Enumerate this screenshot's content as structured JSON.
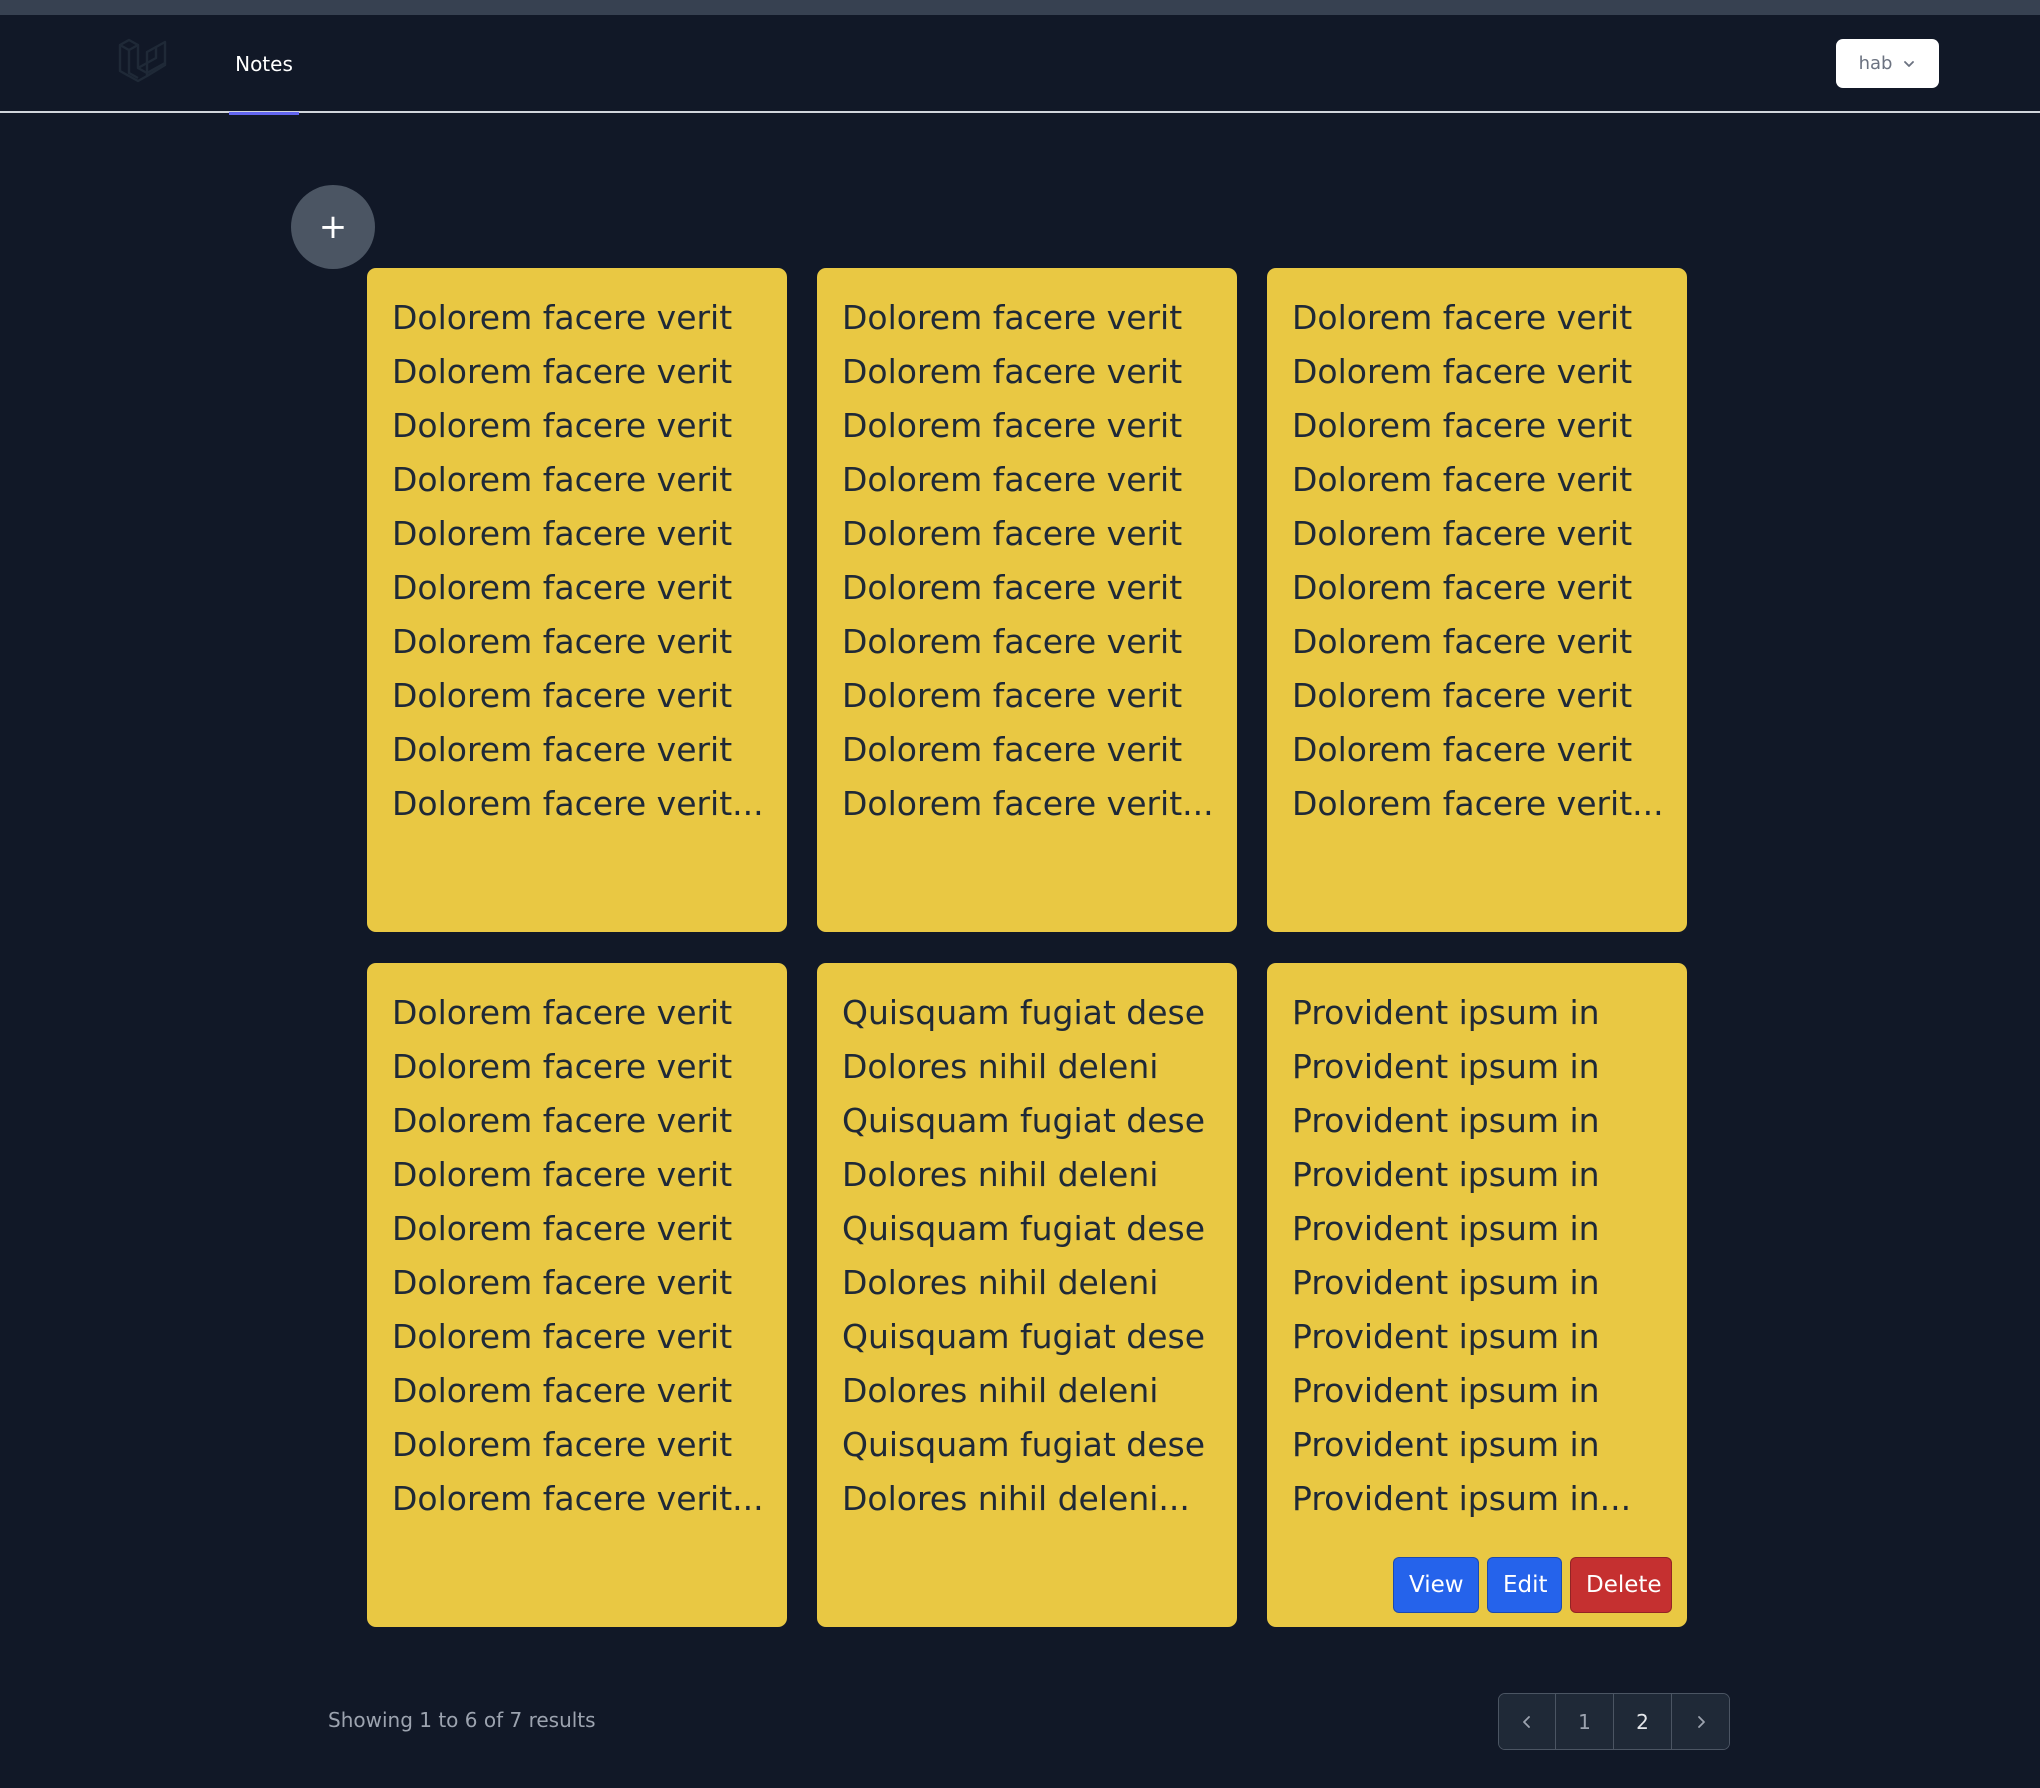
{
  "nav": {
    "link_label": "Notes",
    "user_label": "hab"
  },
  "fab": {
    "label": "+"
  },
  "notes": [
    {
      "lines": [
        "Dolorem facere verit",
        "Dolorem facere verit",
        "Dolorem facere verit",
        "Dolorem facere verit",
        "Dolorem facere verit",
        "Dolorem facere verit",
        "Dolorem facere verit",
        "Dolorem facere verit",
        "Dolorem facere verit",
        "Dolorem facere verit..."
      ]
    },
    {
      "lines": [
        "Dolorem facere verit",
        "Dolorem facere verit",
        "Dolorem facere verit",
        "Dolorem facere verit",
        "Dolorem facere verit",
        "Dolorem facere verit",
        "Dolorem facere verit",
        "Dolorem facere verit",
        "Dolorem facere verit",
        "Dolorem facere verit..."
      ]
    },
    {
      "lines": [
        "Dolorem facere verit",
        "Dolorem facere verit",
        "Dolorem facere verit",
        "Dolorem facere verit",
        "Dolorem facere verit",
        "Dolorem facere verit",
        "Dolorem facere verit",
        "Dolorem facere verit",
        "Dolorem facere verit",
        "Dolorem facere verit..."
      ]
    },
    {
      "lines": [
        "Dolorem facere verit",
        "Dolorem facere verit",
        "Dolorem facere verit",
        "Dolorem facere verit",
        "Dolorem facere verit",
        "Dolorem facere verit",
        "Dolorem facere verit",
        "Dolorem facere verit",
        "Dolorem facere verit",
        "Dolorem facere verit..."
      ]
    },
    {
      "lines": [
        "Quisquam fugiat dese",
        "Dolores nihil deleni",
        "Quisquam fugiat dese",
        "Dolores nihil deleni",
        "Quisquam fugiat dese",
        "Dolores nihil deleni",
        "Quisquam fugiat dese",
        "Dolores nihil deleni",
        "Quisquam fugiat dese",
        "Dolores nihil deleni..."
      ]
    },
    {
      "lines": [
        "Provident ipsum in",
        "Provident ipsum in",
        "Provident ipsum in",
        "Provident ipsum in",
        "Provident ipsum in",
        "Provident ipsum in",
        "Provident ipsum in",
        "Provident ipsum in",
        "Provident ipsum in",
        "Provident ipsum in..."
      ]
    }
  ],
  "actions": {
    "view": "View",
    "edit": "Edit",
    "delete": "Delete"
  },
  "pagination": {
    "results_text": "Showing 1 to 6 of 7 results",
    "pages": [
      "1",
      "2"
    ],
    "prev_icon": "chevron-left-icon",
    "next_icon": "chevron-right-icon"
  },
  "colors": {
    "background": "#111827",
    "note": "#e9c843",
    "primary_button": "#2563eb",
    "danger_button": "#c53030",
    "nav_active": "#6366f1"
  }
}
